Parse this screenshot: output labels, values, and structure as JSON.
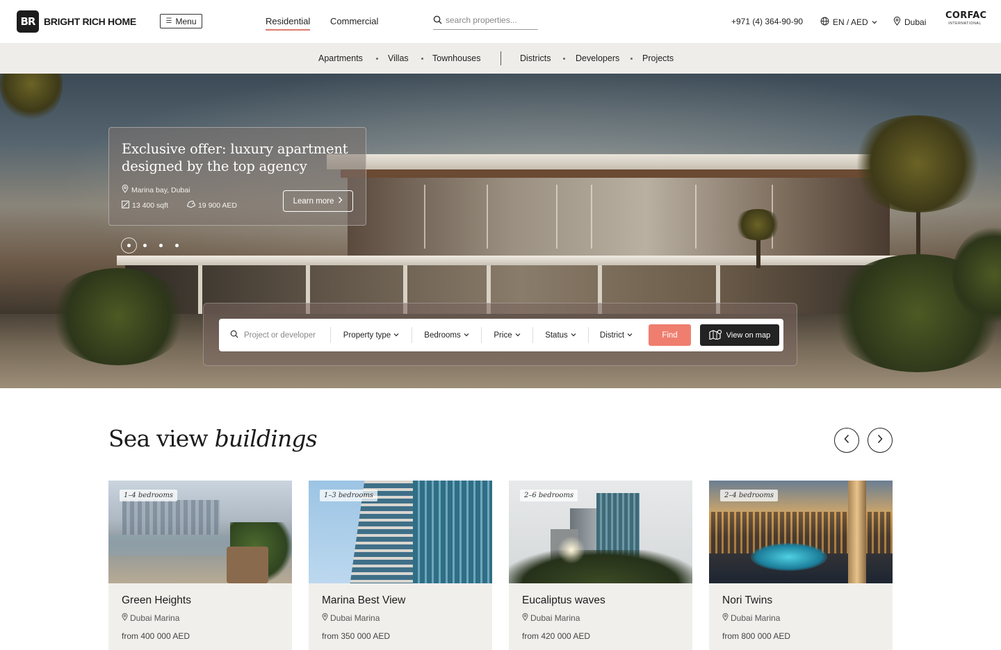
{
  "header": {
    "brand_mark": "BR",
    "brand_name": "BRIGHT RICH HOME",
    "menu_label": "Menu",
    "tabs": [
      {
        "label": "Residential",
        "active": true
      },
      {
        "label": "Commercial",
        "active": false
      }
    ],
    "search_placeholder": "search properties...",
    "phone": "+971 (4) 364-90-90",
    "locale": "EN / AED",
    "city": "Dubai",
    "partner_line1": "CORFAC",
    "partner_line2": "INTERNATIONAL"
  },
  "subnav": {
    "left": [
      "Apartments",
      "Villas",
      "Townhouses"
    ],
    "right": [
      "Districts",
      "Developers",
      "Projects"
    ]
  },
  "hero": {
    "offer_title": "Exclusive offer: luxury apartment designed by the top agency",
    "location": "Marina bay, Dubai",
    "area": "13 400 sqft",
    "price": "19 900 AED",
    "cta": "Learn more",
    "slides_total": 4,
    "active_slide": 1
  },
  "filter": {
    "search_placeholder": "Project or developer",
    "selects": [
      "Property type",
      "Bedrooms",
      "Price",
      "Status",
      "District"
    ],
    "find_label": "Find",
    "map_label": "View on map"
  },
  "section": {
    "title_plain": "Sea view",
    "title_italic": "buildings"
  },
  "cards": [
    {
      "badge": "1–4 bedrooms",
      "name": "Green Heights",
      "location": "Dubai Marina",
      "price": "from 400 000 AED"
    },
    {
      "badge": "1–3 bedrooms",
      "name": "Marina Best View",
      "location": "Dubai Marina",
      "price": "from 350 000 AED"
    },
    {
      "badge": "2–6 bedrooms",
      "name": "Eucaliptus waves",
      "location": "Dubai Marina",
      "price": "from 420 000 AED"
    },
    {
      "badge": "2–4 bedrooms",
      "name": "Nori Twins",
      "location": "Dubai Marina",
      "price": "from 800 000 AED"
    }
  ],
  "colors": {
    "accent": "#ef7e6f",
    "dark": "#232323",
    "subnav_bg": "#efedea",
    "card_bg": "#f1efec"
  },
  "icons": [
    "search-icon",
    "globe-icon",
    "chevron-down-icon",
    "location-pin-icon",
    "area-icon",
    "price-tag-icon",
    "chevron-right-icon",
    "map-icon",
    "arrow-left-icon",
    "arrow-right-icon"
  ]
}
